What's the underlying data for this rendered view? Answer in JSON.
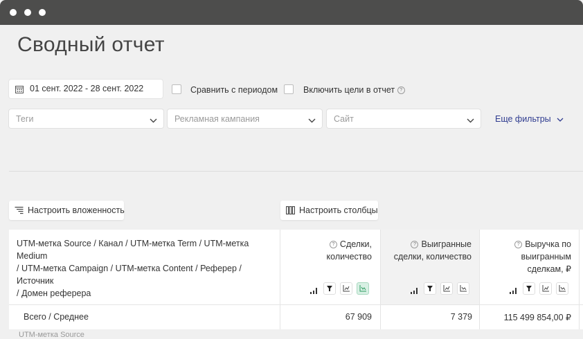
{
  "page": {
    "title": "Сводный отчет"
  },
  "filters": {
    "date_range": "01 сент. 2022 - 28 сент. 2022",
    "compare_label": "Сравнить с периодом",
    "include_goals_label": "Включить цели в отчет",
    "tags_placeholder": "Теги",
    "campaign_placeholder": "Рекламная кампания",
    "site_placeholder": "Сайт",
    "more_filters": "Еще фильтры"
  },
  "toolbar": {
    "nesting_button": "Настроить вложенность",
    "columns_button": "Настроить столбцы"
  },
  "table": {
    "dimension_header_line1": "UTM-метка Source / Канал / UTM-метка Term / UTM-метка Medium",
    "dimension_header_line2": "/ UTM-метка Campaign / UTM-метка Content / Реферер / Источник",
    "dimension_header_line3": "/ Домен реферера",
    "columns": [
      {
        "line1": "Сделки,",
        "line2": "количество",
        "line3": ""
      },
      {
        "line1": "Выигранные",
        "line2": "сделки, количество",
        "line3": ""
      },
      {
        "line1": "Выручка по",
        "line2": "выигранным",
        "line3": "сделкам, ₽"
      }
    ],
    "total_row": {
      "label": "Всего / Среднее",
      "values": [
        "67 909",
        "7 379",
        "115 499 854,00 ₽"
      ]
    },
    "next_row_partial": "UTM-метка Source"
  },
  "icons": {
    "calendar": "calendar-icon",
    "help": "question-circle-icon",
    "chevron": "chevron-down-icon",
    "nesting": "tree-list-icon",
    "columns": "columns-icon",
    "sort": "bar-sort-icon",
    "filter": "funnel-icon",
    "chart": "line-chart-icon"
  },
  "colors": {
    "titlebar": "#4d4d4c",
    "link": "#2e3b8f",
    "active_chart": "#d8f0e4",
    "highlight_column": "#f2f2f2"
  }
}
